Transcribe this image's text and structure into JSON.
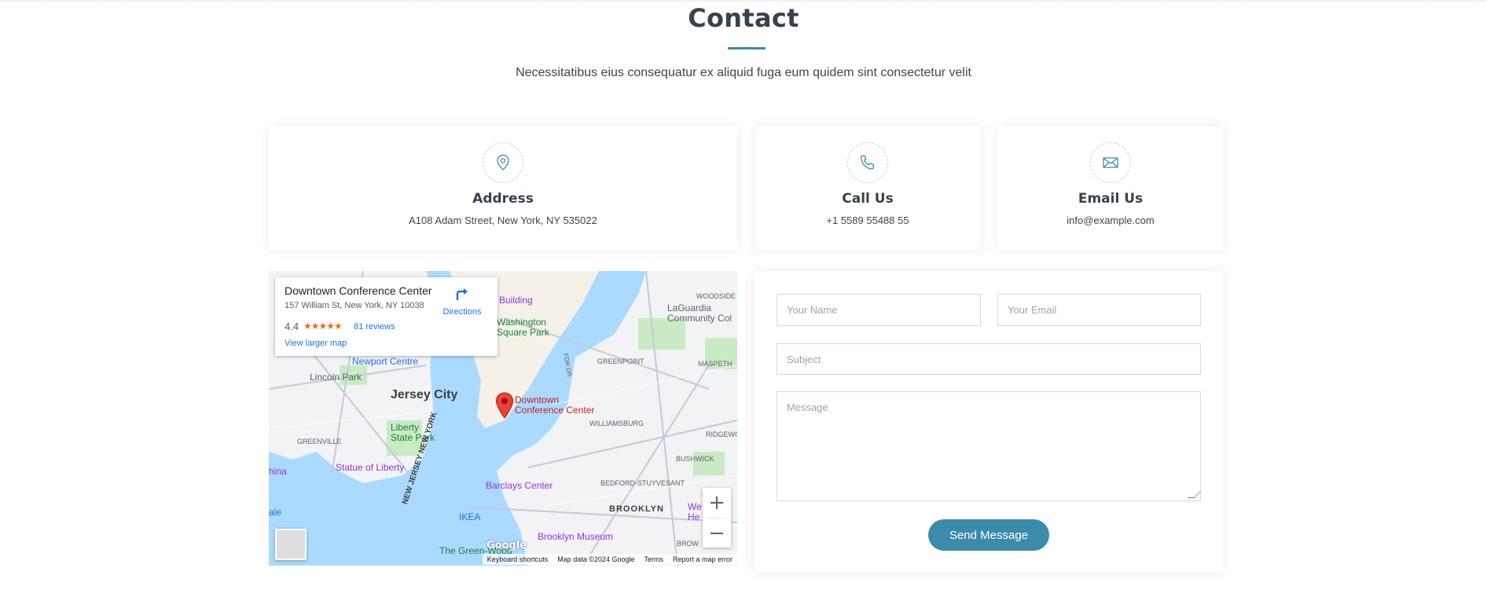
{
  "section": {
    "title": "Contact",
    "subtitle": "Necessitatibus eius consequatur ex aliquid fuga eum quidem sint consectetur velit"
  },
  "cards": {
    "address": {
      "icon": "map-pin-icon",
      "title": "Address",
      "text": "A108 Adam Street, New York, NY 535022"
    },
    "call": {
      "icon": "phone-icon",
      "title": "Call Us",
      "text": "+1 5589 55488 55"
    },
    "email": {
      "icon": "envelope-icon",
      "title": "Email Us",
      "text": "info@example.com"
    }
  },
  "map": {
    "place_name": "Downtown Conference Center",
    "place_address": "157 William St, New York, NY 10038",
    "rating": "4.4",
    "stars": "★★★★★",
    "reviews": "81 reviews",
    "directions": "Directions",
    "larger_map": "View larger map",
    "pin_label": "Downtown Conference Center",
    "pin_label_line1": "Downtown",
    "pin_label_line2": "Conference Center",
    "zoom_in": "+",
    "zoom_out": "−",
    "google": "Google",
    "attribution": {
      "shortcuts": "Keyboard shortcuts",
      "data": "Map data ©2024 Google",
      "terms": "Terms",
      "report": "Report a map error"
    },
    "labels": {
      "jersey_city": "Jersey City",
      "lincoln_park": "Lincoln Park",
      "liberty_state_park": "Liberty State Park",
      "statue_of_liberty": "Statue of Liberty",
      "newport_centre": "Newport Centre",
      "barclays_center": "Barclays Center",
      "brooklyn": "BROOKLYN",
      "brooklyn_museum": "Brooklyn Museum",
      "ikea": "IKEA",
      "greenville": "GREENVILLE",
      "williamsburg": "WILLIAMSBURG",
      "greenpoint": "GREENPOINT",
      "bushwick": "BUSHWICK",
      "bedford_stuyvesant": "BEDFORD-STUYVESANT",
      "ridgewood": "RIDGEWOOD",
      "maspeth": "MASPETH",
      "woodside": "WOODSIDE",
      "laguardia": "LaGuardia Community Col",
      "washington_square": "Washington Square Park",
      "building": "Building",
      "green_wood": "The Green-Wood",
      "new_jersey_new_york": "NEW JERSEY NEW YORK",
      "fdr_dr": "FDR DR",
      "brow": "BROW",
      "china": "hina",
      "ale": "ale",
      "we_he": "We He"
    }
  },
  "form": {
    "name_placeholder": "Your Name",
    "email_placeholder": "Your Email",
    "subject_placeholder": "Subject",
    "message_placeholder": "Message",
    "submit_label": "Send Message"
  },
  "colors": {
    "accent": "#3b8bab",
    "heading": "#37424e"
  }
}
